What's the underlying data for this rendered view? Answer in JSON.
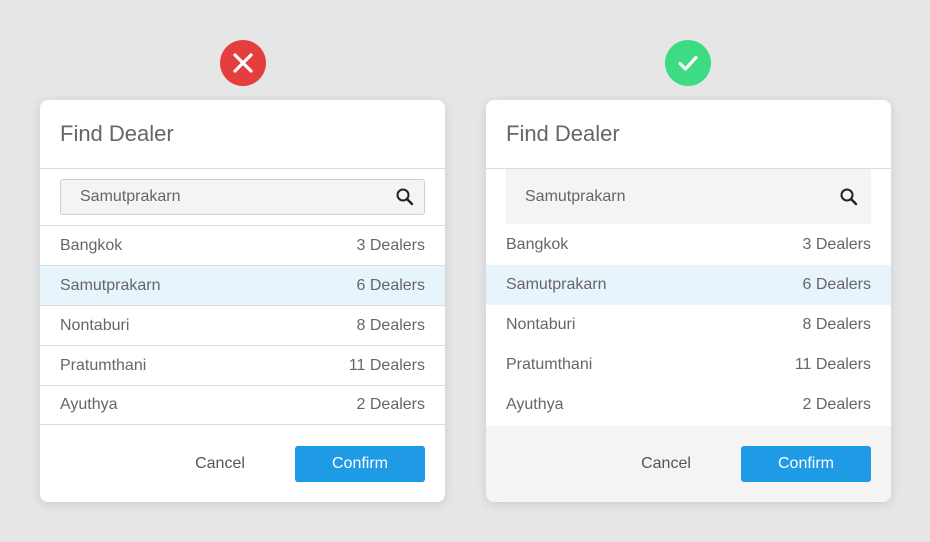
{
  "colors": {
    "bad_badge": "#e53e3e",
    "good_badge": "#3ddc84",
    "confirm_button": "#1f9be6",
    "selected_row": "#e8f4fc"
  },
  "bad_example": {
    "badge_icon": "cross-icon",
    "title": "Find Dealer",
    "search": {
      "value": "Samutprakarn",
      "icon": "search-icon"
    },
    "rows": [
      {
        "name": "Bangkok",
        "count": "3 Dealers"
      },
      {
        "name": "Samutprakarn",
        "count": "6 Dealers",
        "selected": true
      },
      {
        "name": "Nontaburi",
        "count": "8 Dealers"
      },
      {
        "name": "Pratumthani",
        "count": "11 Dealers"
      },
      {
        "name": "Ayuthya",
        "count": "2 Dealers"
      }
    ],
    "cancel_label": "Cancel",
    "confirm_label": "Confirm"
  },
  "good_example": {
    "badge_icon": "check-icon",
    "title": "Find Dealer",
    "search": {
      "value": "Samutprakarn",
      "icon": "search-icon"
    },
    "rows": [
      {
        "name": "Bangkok",
        "count": "3 Dealers"
      },
      {
        "name": "Samutprakarn",
        "count": "6 Dealers",
        "selected": true
      },
      {
        "name": "Nontaburi",
        "count": "8 Dealers"
      },
      {
        "name": "Pratumthani",
        "count": "11 Dealers"
      },
      {
        "name": "Ayuthya",
        "count": "2 Dealers"
      }
    ],
    "cancel_label": "Cancel",
    "confirm_label": "Confirm"
  }
}
